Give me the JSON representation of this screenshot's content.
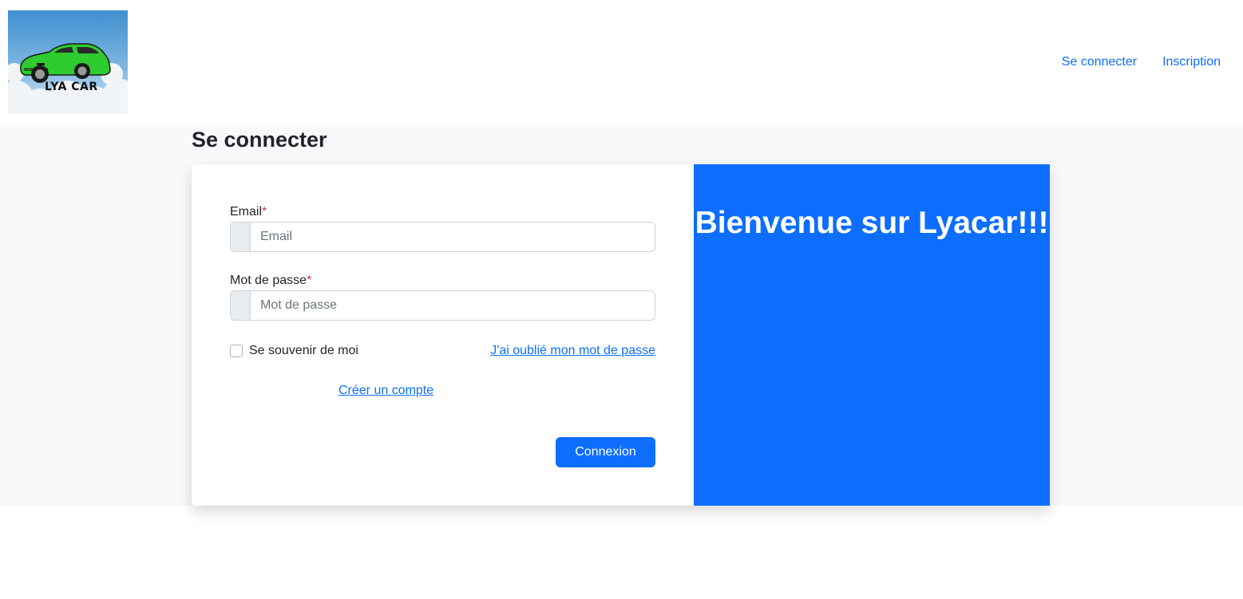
{
  "header": {
    "logo_text": "LYA CAR",
    "nav": {
      "login": "Se connecter",
      "signup": "Inscription"
    }
  },
  "page": {
    "title": "Se connecter"
  },
  "form": {
    "email": {
      "label": "Email",
      "required_mark": "*",
      "placeholder": "Email"
    },
    "password": {
      "label": "Mot de passe",
      "required_mark": "*",
      "placeholder": "Mot de passe"
    },
    "remember_label": "Se souvenir de moi",
    "forgot_link": "J'ai oublié mon mot de passe",
    "create_account_link": "Créer un compte",
    "submit_label": "Connexion"
  },
  "welcome": {
    "text": "Bienvenue sur Lyacar!!!"
  },
  "colors": {
    "primary": "#0d6efd",
    "band": "#f8f9fa",
    "required": "#dc3545",
    "car": "#2ecc2e"
  }
}
